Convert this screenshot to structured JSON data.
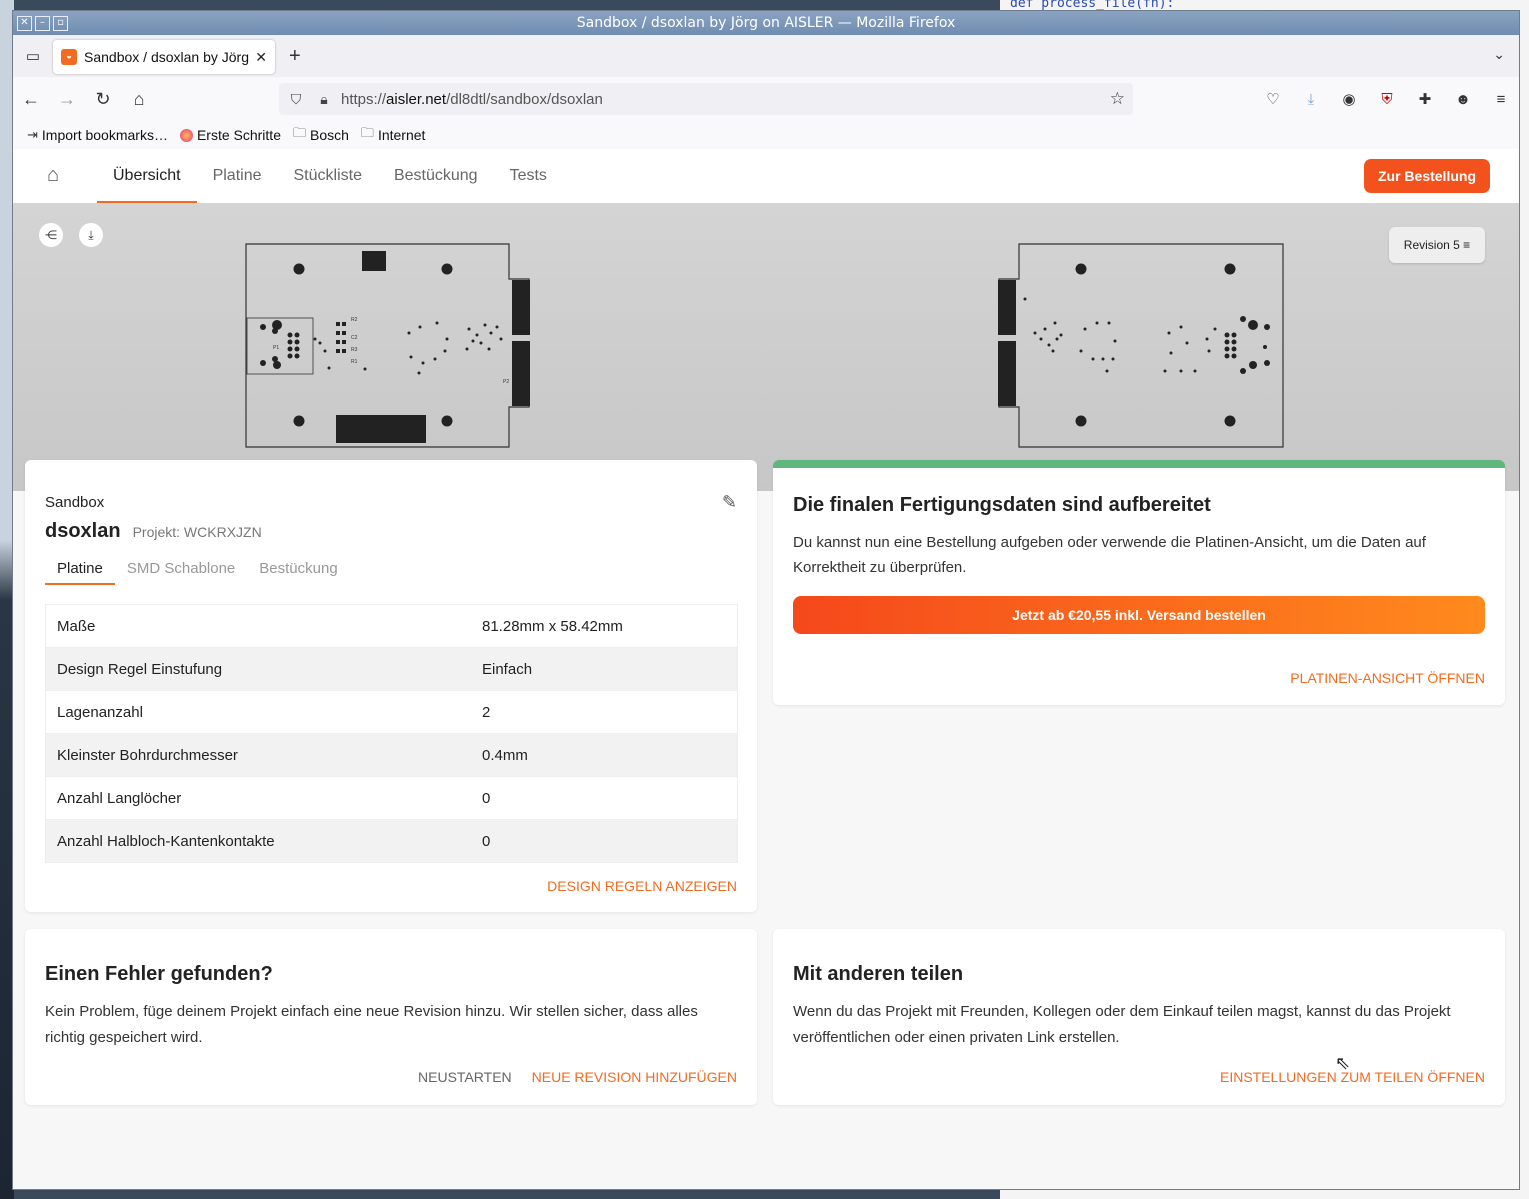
{
  "window": {
    "title": "Sandbox / dsoxlan by Jörg on AISLER — Mozilla Firefox"
  },
  "tab": {
    "title": "Sandbox / dsoxlan by Jörg",
    "close": "✕"
  },
  "url": {
    "prefix": "https://",
    "host": "aisler.net",
    "path": "/dl8dtl/sandbox/dsoxlan"
  },
  "bookmarks": [
    "Import bookmarks…",
    "Erste Schritte",
    "Bosch",
    "Internet"
  ],
  "appnav": {
    "links": [
      "Übersicht",
      "Platine",
      "Stückliste",
      "Bestückung",
      "Tests"
    ],
    "order_button": "Zur Bestellung"
  },
  "hero": {
    "revision": "Revision 5"
  },
  "project": {
    "group": "Sandbox",
    "name": "dsoxlan",
    "project_id": "Projekt: WCKRXJZN",
    "tabs": [
      "Platine",
      "SMD Schablone",
      "Bestückung"
    ],
    "specs": [
      {
        "label": "Maße",
        "value": "81.28mm x 58.42mm"
      },
      {
        "label": "Design Regel Einstufung",
        "value": "Einfach"
      },
      {
        "label": "Lagenanzahl",
        "value": "2"
      },
      {
        "label": "Kleinster Bohrdurchmesser",
        "value": "0.4mm"
      },
      {
        "label": "Anzahl Langlöcher",
        "value": "0"
      },
      {
        "label": "Anzahl Halbloch-Kantenkontakte",
        "value": "0"
      }
    ],
    "design_rules_link": "DESIGN REGELN ANZEIGEN"
  },
  "ready": {
    "title": "Die finalen Fertigungsdaten sind aufbereitet",
    "text": "Du kannst nun eine Bestellung aufgeben oder verwende die Platinen-Ansicht, um die Daten auf Korrektheit zu überprüfen.",
    "order_button": "Jetzt ab €20,55 inkl. Versand bestellen",
    "view_link": "PLATINEN-ANSICHT ÖFFNEN"
  },
  "error": {
    "title": "Einen Fehler gefunden?",
    "text": "Kein Problem, füge deinem Projekt einfach eine neue Revision hinzu. Wir stellen sicher, dass alles richtig gespeichert wird.",
    "restart": "NEUSTARTEN",
    "new_revision": "NEUE REVISION HINZUFÜGEN"
  },
  "share": {
    "title": "Mit anderen teilen",
    "text": "Wenn du das Projekt mit Freunden, Kollegen oder dem Einkauf teilen magst, kannst du das Projekt veröffentlichen oder einen privaten Link erstellen.",
    "settings_link": "EINSTELLUNGEN ZUM TEILEN ÖFFNEN"
  },
  "pcb_labels": {
    "p1": "P1",
    "p2": "P2",
    "r2": "R2",
    "r1": "R1",
    "r3": "R3",
    "c2": "C2"
  },
  "background_code": "def process_file(fn):",
  "colors": {
    "accent": "#f26b21",
    "cta_start": "#f5481b",
    "cta_end": "#ff8a1d",
    "success": "#5fb77d"
  }
}
